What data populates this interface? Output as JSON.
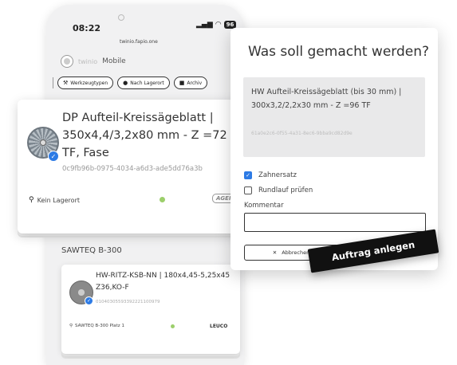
{
  "status_bar": {
    "time": "08:22",
    "battery": "96",
    "url": "twinio.fapio.one"
  },
  "app": {
    "name": "Mobile",
    "brand": "twinio"
  },
  "filters": [
    {
      "icon": "tool-icon",
      "label": "Werkzeugtypen"
    },
    {
      "icon": "location-pin-icon",
      "label": "Nach Lagerort"
    },
    {
      "icon": "archive-icon",
      "label": "Archiv"
    }
  ],
  "main_card": {
    "title": "DP Aufteil-Kreissägeblatt | 350x4,4/3,2x80 mm - Z =72 TF, Fase",
    "uuid": "0c9fb96b-0975-4034-a6d3-ade5dd76a3b",
    "location": "Kein Lagerort",
    "tag": "AGER"
  },
  "group": {
    "title": "SAWTEQ B-300",
    "card": {
      "title": "HW-RITZ-KSB-NN | 180x4,45-5,25x45 Z36,KO-F",
      "ids": "01040305593392221100979",
      "location": "SAWTEQ B-300 Platz 1",
      "brand": "LEUCO"
    }
  },
  "dialog": {
    "title": "Was soll gemacht werden?",
    "selected_item": "HW Aufteil-Kreissägeblatt (bis 30 mm) | 300x3,2/2,2x30 mm - Z =96 TF",
    "selected_uuid": "61a0e2c6-0f55-4a31-8ec6-9bba9cd82d9e",
    "options": [
      {
        "label": "Zahnersatz",
        "checked": true
      },
      {
        "label": "Rundlauf prüfen",
        "checked": false
      }
    ],
    "comment_label": "Kommentar",
    "comment_value": "",
    "cancel_label": "Abbrechen"
  },
  "action_button": "Auftrag anlegen",
  "colors": {
    "accent_blue": "#2d7be5",
    "status_green": "#9ccf6b",
    "action_black": "#111111"
  }
}
